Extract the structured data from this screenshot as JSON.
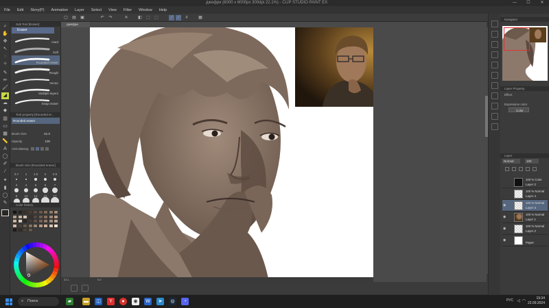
{
  "app": {
    "title": "джефри (6000 x 6000px 300dpi 22.1%) - CLIP STUDIO PAINT EX",
    "window_controls": [
      "—",
      "☐",
      "✕"
    ]
  },
  "menu": [
    "File",
    "Edit",
    "Story(P)",
    "Animation",
    "Layer",
    "Select",
    "View",
    "Filter",
    "Window",
    "Help"
  ],
  "left_panel": {
    "sub_tool_header": "Sub Tool [Eraser]",
    "sub_tool_group": "Eraser",
    "brushes": [
      {
        "label": "Hard",
        "selected": false
      },
      {
        "label": "Soft",
        "selected": false
      },
      {
        "label": "Rounded eraser",
        "selected": true
      },
      {
        "label": "Rough",
        "selected": false
      },
      {
        "label": "Vector",
        "selected": false
      },
      {
        "label": "Multiple layers",
        "selected": false
      },
      {
        "label": "Snap eraser",
        "selected": false
      }
    ],
    "tool_property_header": "Tool property [Rounded er...",
    "tool_property_name": "Rounded eraser",
    "brush_size_label": "Brush Size",
    "brush_size_value": "51.0",
    "opacity_label": "Opacity",
    "opacity_value": "100",
    "antialiasing_label": "Anti-aliasing",
    "brush_size_panel_header": "Brush Size [Rounded eraser]",
    "brush_sizes": [
      "0.7",
      "1",
      "1.5",
      "2",
      "2.5",
      "3",
      "4",
      "5",
      "6",
      "7",
      "8",
      "10",
      "12",
      "15",
      "17"
    ],
    "color_set_header": "Color history",
    "palette_colors": [
      "#1a1410",
      "#2a211c",
      "#3b2f27",
      "#4a3c32",
      "#5a4a3e",
      "#6b584a",
      "#7d6957",
      "#8e7a67",
      "#a08c79",
      "#b29e8a",
      "#c3b09c",
      "#d5c3b0",
      "#3a302a",
      "#55473d",
      "#6e5f52",
      "#876e5e",
      "#a08570",
      "#b89c86",
      "#cdb39d",
      "#e0cbb6",
      "#2d2622",
      "#453a33",
      "#5f5045",
      "#776356",
      "#8f7868",
      "#a58d7c",
      "#bba290",
      "#d0b8a5",
      "#4c3f36",
      "#6a594d",
      "#83705f",
      "#9a8473",
      "#b39985",
      "#c9ae99",
      "#dbc3ae",
      "#ece0d3",
      "#1e1a17",
      "#332b25",
      "#4d4138",
      "#66574a"
    ],
    "color_wheel_hue": "#e87a2a"
  },
  "canvas": {
    "doc_tab": "джефри",
    "status_zoom": "22.1",
    "status_angle": "0.0"
  },
  "right_panel": {
    "navigator_header": "Navigator",
    "layer_property_header": "Layer Property",
    "effect_label": "Effect",
    "expression_color_label": "Expression color",
    "expression_color_value": "Color",
    "layer_header": "Layer",
    "blend_mode": "Normal",
    "opacity": "100",
    "layers": [
      {
        "mode": "100 % Color",
        "name": "Layer 2",
        "thumb": "#111111",
        "selected": false,
        "visible": false
      },
      {
        "mode": "100 % Normal",
        "name": "Layer 4",
        "thumb": "checker",
        "selected": false,
        "visible": false
      },
      {
        "mode": "100 % Normal",
        "name": "Layer 3",
        "thumb": "checker",
        "selected": true,
        "visible": true
      },
      {
        "mode": "100 % Normal",
        "name": "Layer 1",
        "thumb": "photo",
        "selected": false,
        "visible": true
      },
      {
        "mode": "100 % Normal",
        "name": "Layer 2",
        "thumb": "checker",
        "selected": false,
        "visible": true
      },
      {
        "mode": "",
        "name": "Paper",
        "thumb": "#ffffff",
        "selected": false,
        "visible": true
      }
    ]
  },
  "taskbar": {
    "search_placeholder": "Поиск",
    "language": "РУС",
    "time": "19:34",
    "date": "22.09.2024"
  },
  "colors": {
    "accent_selected": "#56667f",
    "sepia_mid": "#8a7566",
    "sepia_dark": "#5c4a40",
    "photo_bg": "#3a2a14"
  }
}
